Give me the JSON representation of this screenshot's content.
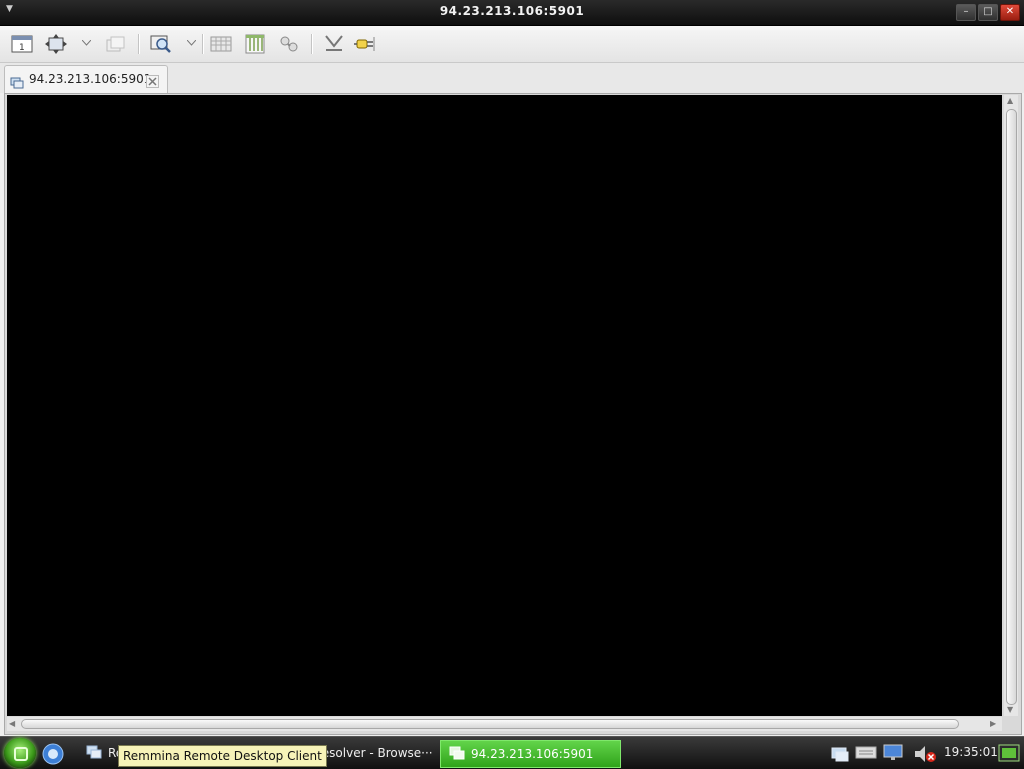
{
  "window": {
    "title": "94.23.213.106:5901"
  },
  "toolbar": {
    "items": [
      {
        "name": "toggle-fullscreen-icon"
      },
      {
        "name": "scaled-mode-icon"
      },
      {
        "name": "switch-tab-icon"
      },
      {
        "name": "scale-icon"
      },
      {
        "name": "grab-keyboard-icon"
      },
      {
        "name": "preferences-icon"
      },
      {
        "name": "tools-icon"
      },
      {
        "name": "minimize-icon"
      },
      {
        "name": "disconnect-icon"
      }
    ]
  },
  "tabs": [
    {
      "label": "94.23.213.106:5901"
    }
  ],
  "taskbar": {
    "tasks": [
      {
        "label": "Re"
      },
      {
        "label": "Resolver - Browse···"
      },
      {
        "label": "94.23.213.106:5901",
        "active": true
      }
    ],
    "tooltip": "Remmina Remote Desktop Client",
    "clock": "19:35:01"
  },
  "colors": {
    "viewport": "#000000",
    "active_task": "#3fb826",
    "close_button": "#c0301f"
  }
}
